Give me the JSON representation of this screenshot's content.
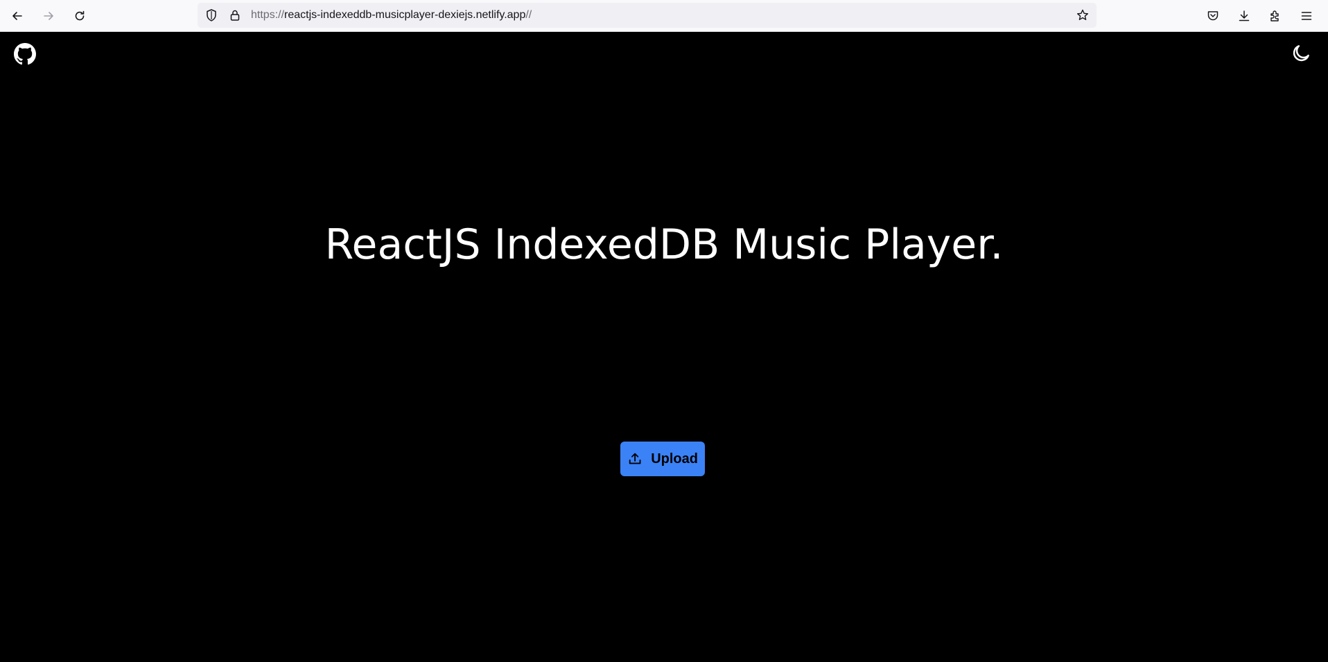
{
  "browser": {
    "url_prefix": "https://",
    "url_host": "reactjs-indexeddb-musicplayer-dexiejs.netlify.app",
    "url_suffix": "//",
    "icons": [
      "back-icon",
      "forward-icon",
      "reload-icon",
      "shield-icon",
      "lock-icon",
      "star-icon",
      "pocket-icon",
      "download-icon",
      "extensions-icon",
      "menu-icon"
    ]
  },
  "page": {
    "title": "ReactJS IndexedDB Music Player.",
    "upload_label": "Upload",
    "colors": {
      "background": "#000000",
      "title": "#ffffff",
      "upload_button": "#3b82f6"
    },
    "icons": {
      "top_left": "github-icon",
      "top_right": "moon-icon",
      "upload": "upload-icon"
    }
  }
}
